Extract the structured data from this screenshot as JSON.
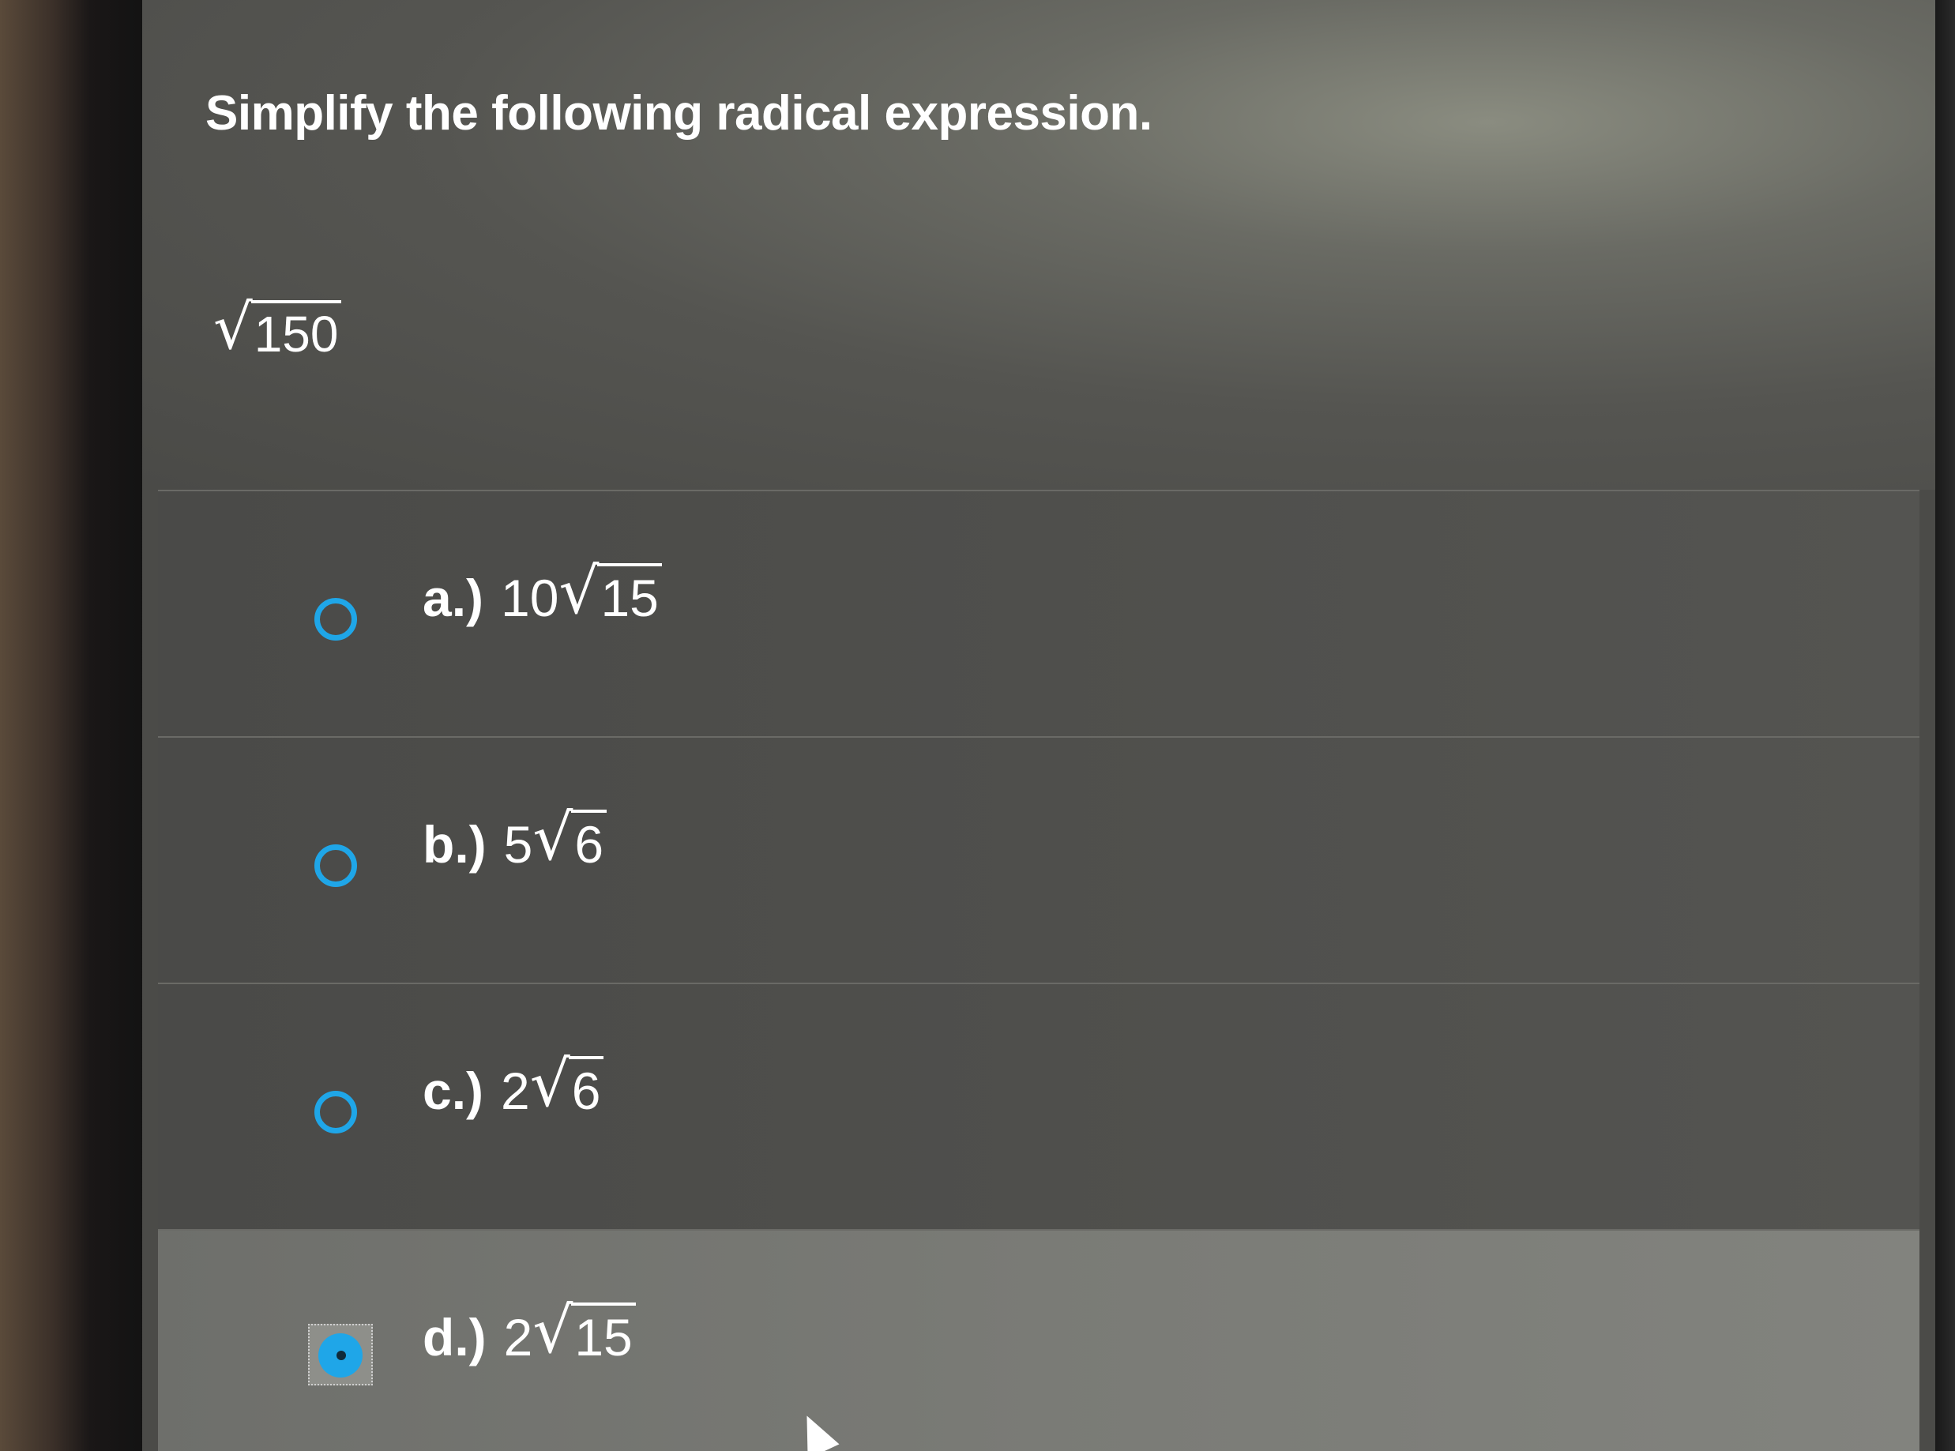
{
  "question": {
    "title": "Simplify the following radical expression.",
    "expression_radicand": "150"
  },
  "options": [
    {
      "letter": "a.)",
      "coefficient": "10",
      "radicand": "15",
      "selected": false
    },
    {
      "letter": "b.)",
      "coefficient": "5",
      "radicand": "6",
      "selected": false
    },
    {
      "letter": "c.)",
      "coefficient": "2",
      "radicand": "6",
      "selected": false
    },
    {
      "letter": "d.)",
      "coefficient": "2",
      "radicand": "15",
      "selected": true
    }
  ],
  "symbols": {
    "radical": "√"
  },
  "colors": {
    "accent": "#1fa6e8",
    "text": "#ffffff",
    "selected_row": "#7a7b76"
  }
}
